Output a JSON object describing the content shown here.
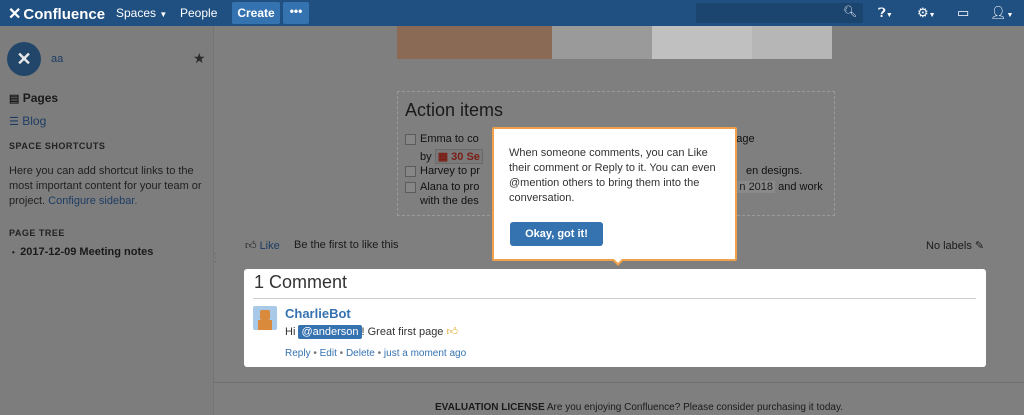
{
  "header": {
    "logo": "Confluence",
    "nav": [
      "Spaces",
      "People"
    ],
    "create_label": "Create",
    "more_label": "•••",
    "search_placeholder": ""
  },
  "sidebar": {
    "space_name": "aa",
    "pages_label": "Pages",
    "blog_label": "Blog",
    "shortcuts_heading": "SPACE SHORTCUTS",
    "shortcuts_text": "Here you can add shortcut links to the most important content for your team or project.",
    "configure_link": "Configure sidebar.",
    "page_tree_heading": "PAGE TREE",
    "tree_item": "2017-12-09 Meeting notes"
  },
  "action_items": {
    "title": "Action items",
    "tasks": [
      {
        "before": "Emma to co",
        "after": "ate page"
      },
      {
        "before": "by",
        "date": "30 Se"
      },
      {
        "before": "Harvey to pr",
        "after": "en designs."
      },
      {
        "before": "Alana to pro",
        "date": "n 2018",
        "after": "and work"
      },
      {
        "before": "with the des"
      }
    ]
  },
  "like_row": {
    "like_label": "Like",
    "first_to_like": "Be the first to like this",
    "no_labels": "No labels"
  },
  "comments": {
    "heading": "1 Comment",
    "author": "CharlieBot",
    "text_before": "Hi",
    "mention": "@anderson",
    "text_after": "! Great first page",
    "actions": [
      "Reply",
      "Edit",
      "Delete",
      "just a moment ago"
    ]
  },
  "tooltip": {
    "text_html": "When someone comments, you can Like their comment or Reply to it. You can even @mention others to bring them into the conversation.",
    "ok_label": "Okay, got it!"
  },
  "footer": {
    "license_label": "EVALUATION LICENSE",
    "license_text": "Are you enjoying Confluence? Please consider purchasing it today."
  },
  "colors": {
    "header_bg": "#205081",
    "accent": "#3572b0",
    "tooltip_border": "#f0a04b",
    "overlay_bg": "#7f7f7f"
  }
}
